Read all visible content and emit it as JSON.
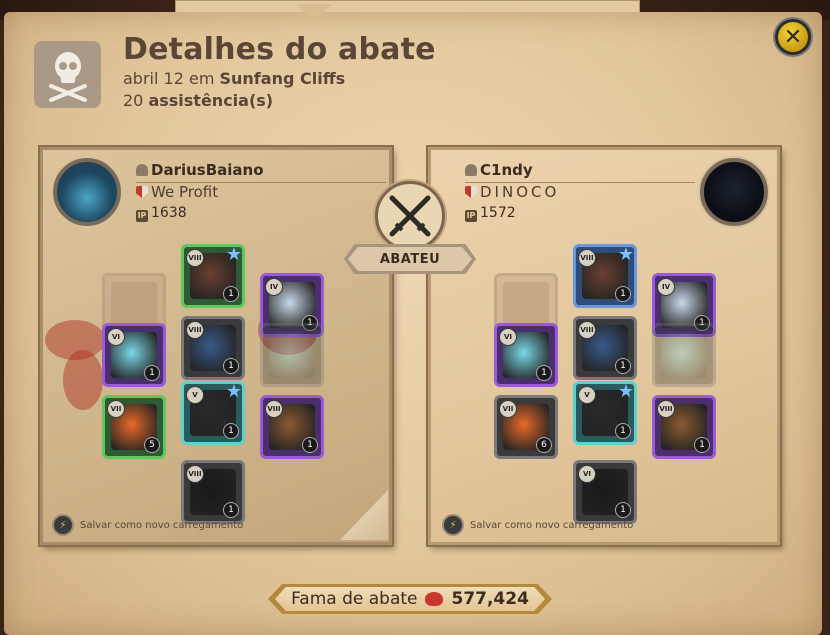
{
  "header": {
    "title": "Detalhes do abate",
    "date": "abril 12",
    "date_connector": "em",
    "location": "Sunfang Cliffs",
    "assist_count": "20",
    "assist_label": "assistência(s)"
  },
  "center": {
    "result_label": "ABATEU"
  },
  "killer": {
    "name": "DariusBaiano",
    "guild": "We Profit",
    "item_power": "1638",
    "save_loadout_label": "Salvar como novo carregamento",
    "slots": [
      {
        "id": "bag",
        "empty": true
      },
      {
        "id": "head",
        "tier": "VIII",
        "qty": "1",
        "rarity": "green",
        "star": true,
        "icon": "cowl-icon"
      },
      {
        "id": "cape",
        "tier": "IV",
        "qty": "1",
        "rarity": "purple",
        "icon": "cape-icon"
      },
      {
        "id": "mainhand",
        "tier": "VI",
        "qty": "1",
        "rarity": "purple",
        "icon": "crystal-weapon-icon"
      },
      {
        "id": "chest",
        "tier": "VIII",
        "qty": "1",
        "rarity": "gray",
        "icon": "armor-icon"
      },
      {
        "id": "offhand",
        "ghost": true,
        "icon": "crystal-weapon-icon"
      },
      {
        "id": "potion",
        "tier": "VII",
        "qty": "5",
        "rarity": "green",
        "icon": "potion-icon"
      },
      {
        "id": "shoes",
        "tier": "V",
        "qty": "1",
        "rarity": "cyan",
        "star": true,
        "icon": "boots-icon"
      },
      {
        "id": "food",
        "tier": "VIII",
        "qty": "1",
        "rarity": "purple",
        "icon": "stew-icon"
      },
      {
        "id": "mount",
        "tier": "VIII",
        "qty": "1",
        "rarity": "gray",
        "icon": "panther-icon"
      }
    ]
  },
  "victim": {
    "name": "C1ndy",
    "guild": "DINOCO",
    "item_power": "1572",
    "save_loadout_label": "Salvar como novo carregamento",
    "slots": [
      {
        "id": "bag",
        "empty": true
      },
      {
        "id": "head",
        "tier": "VIII",
        "qty": "1",
        "rarity": "blue",
        "star": true,
        "icon": "cowl-icon"
      },
      {
        "id": "cape",
        "tier": "IV",
        "qty": "1",
        "rarity": "purple",
        "icon": "cape-icon"
      },
      {
        "id": "mainhand",
        "tier": "VI",
        "qty": "1",
        "rarity": "purple",
        "icon": "crystal-weapon-icon"
      },
      {
        "id": "chest",
        "tier": "VIII",
        "qty": "1",
        "rarity": "gray",
        "icon": "armor-icon"
      },
      {
        "id": "offhand",
        "ghost": true,
        "icon": "crystal-weapon-icon"
      },
      {
        "id": "potion",
        "tier": "VII",
        "qty": "6",
        "rarity": "gray",
        "icon": "potion-icon"
      },
      {
        "id": "shoes",
        "tier": "V",
        "qty": "1",
        "rarity": "cyan",
        "star": true,
        "icon": "boots-icon"
      },
      {
        "id": "food",
        "tier": "VIII",
        "qty": "1",
        "rarity": "purple",
        "icon": "stew-icon"
      },
      {
        "id": "mount",
        "tier": "VI",
        "qty": "1",
        "rarity": "gray",
        "icon": "panther-icon"
      }
    ]
  },
  "fame": {
    "label": "Fama de abate",
    "value": "577,424"
  },
  "colors": {
    "parchment": "#e2c69c",
    "text": "#5a4636",
    "close_button": "#e0b82a",
    "fame_border": "#b48a3a"
  }
}
